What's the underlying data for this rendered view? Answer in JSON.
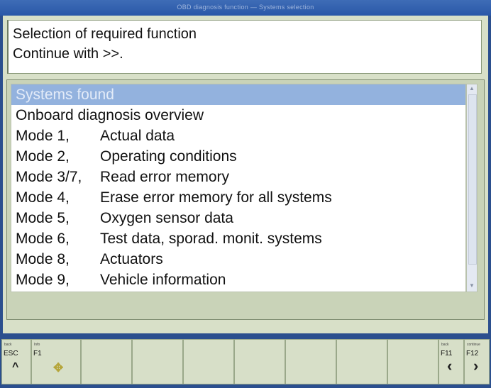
{
  "window": {
    "title": "OBD diagnosis function — Systems selection"
  },
  "message": {
    "lines": [
      "Selection of required function",
      "Continue with >>."
    ]
  },
  "list": {
    "items": [
      {
        "mode": "Systems found",
        "function": "",
        "selected": true
      },
      {
        "mode": "Onboard diagnosis overview",
        "function": "",
        "selected": false
      },
      {
        "mode": "Mode 1,",
        "function": "Actual data",
        "selected": false
      },
      {
        "mode": "Mode 2,",
        "function": "Operating conditions",
        "selected": false
      },
      {
        "mode": "Mode 3/7,",
        "function": "Read error memory",
        "selected": false
      },
      {
        "mode": "Mode 4,",
        "function": "Erase error memory for all systems",
        "selected": false
      },
      {
        "mode": "Mode 5,",
        "function": "Oxygen sensor data",
        "selected": false
      },
      {
        "mode": "Mode 6,",
        "function": "Test data, sporad. monit. systems",
        "selected": false
      },
      {
        "mode": "Mode 8,",
        "function": "Actuators",
        "selected": false
      },
      {
        "mode": "Mode 9,",
        "function": "Vehicle information",
        "selected": false
      }
    ]
  },
  "toolbar": {
    "keys": [
      {
        "key": "ESC",
        "caption": "back",
        "icon": "caret-up-icon",
        "glyph": "^"
      },
      {
        "key": "F1",
        "caption": "Info",
        "icon": "settings-icon",
        "glyph": "✥"
      },
      {
        "key": "",
        "caption": "",
        "icon": "",
        "glyph": ""
      },
      {
        "key": "",
        "caption": "",
        "icon": "",
        "glyph": ""
      },
      {
        "key": "",
        "caption": "",
        "icon": "",
        "glyph": ""
      },
      {
        "key": "",
        "caption": "",
        "icon": "",
        "glyph": ""
      },
      {
        "key": "",
        "caption": "",
        "icon": "",
        "glyph": ""
      },
      {
        "key": "",
        "caption": "",
        "icon": "",
        "glyph": ""
      },
      {
        "key": "F11",
        "caption": "back",
        "icon": "chevron-left-icon",
        "glyph": "‹"
      },
      {
        "key": "F12",
        "caption": "continue",
        "icon": "chevron-right-icon",
        "glyph": "›"
      }
    ]
  },
  "colors": {
    "background": "#2b4f8e",
    "panel": "#d8e0c8",
    "selection": "#93b2de"
  }
}
